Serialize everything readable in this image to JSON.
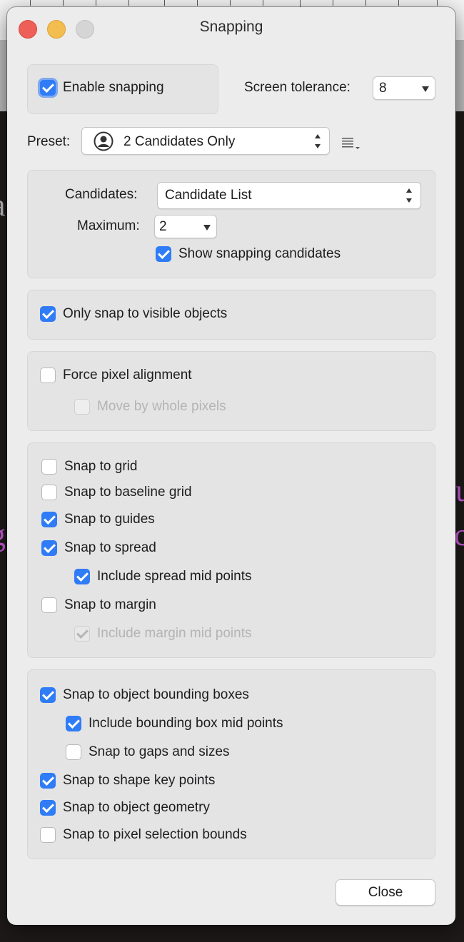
{
  "window": {
    "title": "Snapping",
    "traffic_lights": {
      "close_color": "#ed5f57",
      "minimize_color": "#f4bd4f",
      "zoom_color": "#d5d5d5"
    }
  },
  "background": {
    "glyphs": [
      "a",
      "u",
      "g",
      "c"
    ],
    "glyph_color": "#c75ad6"
  },
  "general": {
    "enable_snapping": {
      "label": "Enable snapping",
      "checked": true
    },
    "screen_tolerance": {
      "label": "Screen tolerance:",
      "value": "8"
    },
    "preset": {
      "label": "Preset:",
      "value": "2 Candidates Only",
      "icon": "person-circle-icon",
      "menu_icon": "list-menu-icon"
    }
  },
  "candidates": {
    "candidates_label": "Candidates:",
    "candidates_value": "Candidate List",
    "maximum_label": "Maximum:",
    "maximum_value": "2",
    "show_candidates": {
      "label": "Show snapping candidates",
      "checked": true
    }
  },
  "visibility": {
    "only_visible": {
      "label": "Only snap to visible objects",
      "checked": true
    }
  },
  "pixel": {
    "force_alignment": {
      "label": "Force pixel alignment",
      "checked": false
    },
    "move_whole_pixels": {
      "label": "Move by whole pixels",
      "checked": false,
      "disabled": true
    }
  },
  "grid_options": [
    {
      "label": "Snap to grid",
      "checked": false
    },
    {
      "label": "Snap to baseline grid",
      "checked": false
    },
    {
      "label": "Snap to guides",
      "checked": true
    },
    {
      "label": "Snap to spread",
      "checked": true
    },
    {
      "label": "Include spread mid points",
      "checked": true
    },
    {
      "label": "Snap to margin",
      "checked": false
    },
    {
      "label": "Include margin mid points",
      "checked": true,
      "disabled": true
    }
  ],
  "object_options": [
    {
      "label": "Snap to object bounding boxes",
      "checked": true
    },
    {
      "label": "Include bounding box mid points",
      "checked": true
    },
    {
      "label": "Snap to gaps and sizes",
      "checked": false
    },
    {
      "label": "Snap to shape key points",
      "checked": true
    },
    {
      "label": "Snap to object geometry",
      "checked": true
    },
    {
      "label": "Snap to pixel selection bounds",
      "checked": false
    }
  ],
  "footer": {
    "close_label": "Close"
  },
  "accent_color": "#2f7cf6"
}
